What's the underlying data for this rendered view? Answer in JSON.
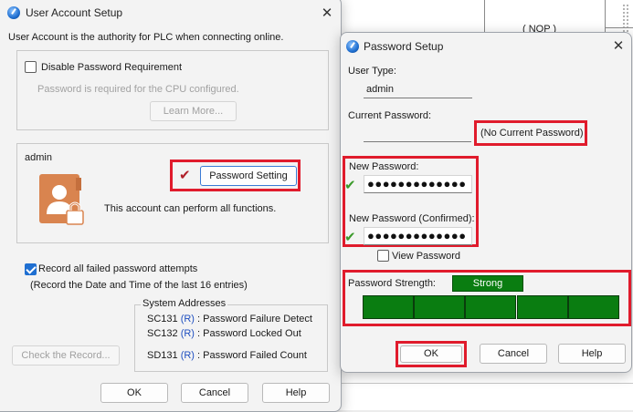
{
  "background": {
    "nop_text": "( NOP )"
  },
  "user_account": {
    "title": "User Account Setup",
    "intro": "User Account is the authority for PLC when connecting online.",
    "disable_pw_label": "Disable Password Requirement",
    "pw_required_text": "Password is required for the CPU configured.",
    "learn_more": "Learn More...",
    "account_name": "admin",
    "password_setting_button": "Password Setting",
    "account_desc": "This account can perform all functions.",
    "record_label": "Record all failed password attempts",
    "record_sub": "(Record the Date and Time of the last 16 entries)",
    "system_addresses": {
      "title": "System Addresses",
      "rows": [
        {
          "addr": "SC131",
          "mode": "(R)",
          "desc": ": Password Failure Detect"
        },
        {
          "addr": "SC132",
          "mode": "(R)",
          "desc": ": Password Locked Out"
        },
        {
          "addr": "SD131",
          "mode": "(R)",
          "desc": ": Password Failed Count"
        }
      ]
    },
    "check_record": "Check the Record...",
    "ok": "OK",
    "cancel": "Cancel",
    "help": "Help"
  },
  "password_setup": {
    "title": "Password Setup",
    "user_type_label": "User Type:",
    "user_type_value": "admin",
    "current_pw_label": "Current Password:",
    "no_current_pw": "(No Current Password)",
    "new_pw_label": "New Password:",
    "new_pw_value": "●●●●●●●●●●●●●",
    "new_pw_confirm_label": "New Password (Confirmed):",
    "new_pw_confirm_value": "●●●●●●●●●●●●●",
    "view_password_label": "View Password",
    "strength_label": "Password Strength:",
    "strength_value": "Strong",
    "strength_level": 5,
    "strength_max": 5,
    "ok": "OK",
    "cancel": "Cancel",
    "help": "Help"
  },
  "colors": {
    "highlight": "#e01b2c",
    "strength": "#0a7d11",
    "accent": "#1f6fd1"
  }
}
